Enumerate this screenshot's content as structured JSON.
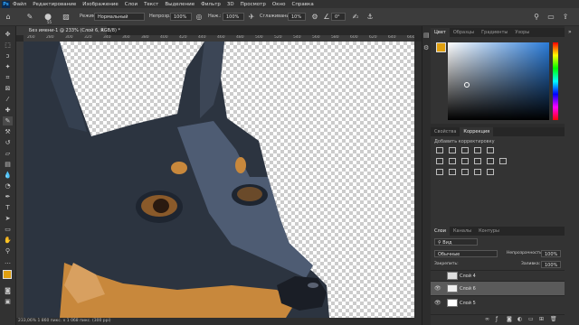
{
  "menu": {
    "logo": "Ps",
    "items": [
      "Файл",
      "Редактирование",
      "Изображение",
      "Слои",
      "Текст",
      "Выделение",
      "Фильтр",
      "3D",
      "Просмотр",
      "Окно",
      "Справка"
    ]
  },
  "options": {
    "brush_size": "55",
    "mode_label": "Режим:",
    "mode_value": "Нормальный",
    "opacity_label": "Непрозр.:",
    "opacity_value": "100%",
    "flow_label": "Наж.:",
    "flow_value": "100%",
    "smoothing_label": "Сглаживание:",
    "smoothing_value": "10%",
    "angle_value": "0°"
  },
  "document": {
    "tab_title": "Без имени-1 @ 233% (Слой 6, RGB/8) *",
    "close": "×",
    "ruler_marks": [
      "260",
      "280",
      "300",
      "320",
      "340",
      "360",
      "380",
      "400",
      "420",
      "440",
      "460",
      "480",
      "500",
      "520",
      "540",
      "560",
      "580",
      "600",
      "620",
      "640",
      "660"
    ],
    "status": "233,06%   1 860 пикс. x 1 068 пикс. (300 ppi)"
  },
  "color_panel": {
    "tabs": [
      "Цвет",
      "Образцы",
      "Градиенты",
      "Узоры"
    ]
  },
  "adjust_panel": {
    "tabs": [
      "Свойства",
      "Коррекция"
    ],
    "hint": "Добавить корректировку"
  },
  "layers_panel": {
    "tabs": [
      "Слои",
      "Каналы",
      "Контуры"
    ],
    "filter_label": "Вид",
    "blend_value": "Обычные",
    "opacity_label": "Непрозрачность:",
    "opacity_value": "100%",
    "lock_label": "Закрепить:",
    "fill_label": "Заливка:",
    "fill_value": "100%",
    "layers": [
      "Слой 4",
      "Слой 6",
      "Слой 5"
    ]
  },
  "colors": {
    "accent": "#31a8ff",
    "foreground": "#e0a010",
    "dog_dark": "#2c3440",
    "dog_blue": "#4e5c73",
    "dog_tan": "#c8883c"
  }
}
